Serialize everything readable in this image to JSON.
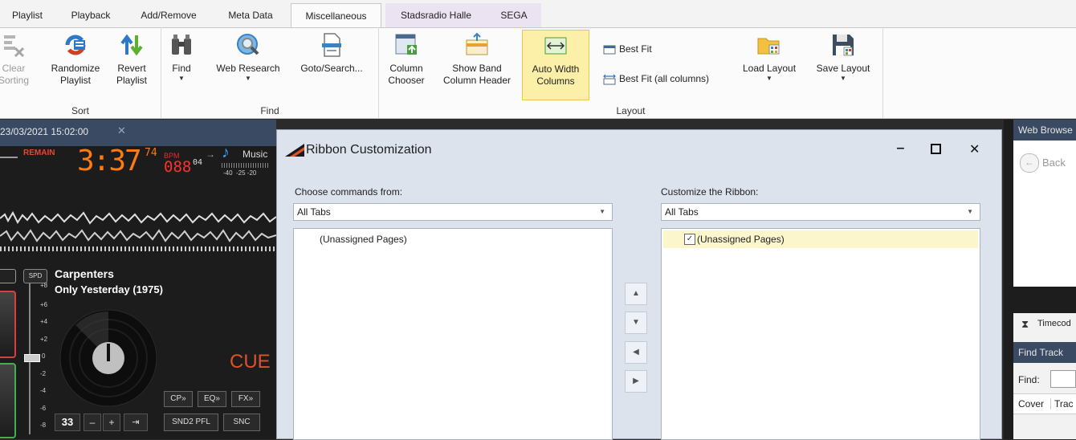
{
  "tabs": [
    {
      "label": "Playlist"
    },
    {
      "label": "Playback"
    },
    {
      "label": "Add/Remove"
    },
    {
      "label": "Meta Data"
    },
    {
      "label": "Miscellaneous"
    },
    {
      "label": "Stadsradio Halle"
    },
    {
      "label": "SEGA"
    }
  ],
  "ribbon": {
    "sort": {
      "label": "Sort",
      "clear": "Clear Sorting",
      "randomize": "Randomize Playlist",
      "revert": "Revert Playlist"
    },
    "find": {
      "label": "Find",
      "find": "Find",
      "web_research": "Web Research",
      "goto": "Goto/Search..."
    },
    "layout": {
      "label": "Layout",
      "column_chooser": "Column Chooser",
      "show_band": "Show Band Column Header",
      "auto_width": "Auto Width Columns",
      "best_fit": "Best Fit",
      "best_fit_all": "Best Fit (all columns)",
      "load_layout": "Load Layout",
      "save_layout": "Save Layout"
    }
  },
  "player": {
    "tab_title": "23/03/2021 15:02:00",
    "remain_label": "REMAIN",
    "time": "3:37",
    "time_frac": "74",
    "bpm_label": "BPM",
    "bpm": "088",
    "bpm_frac": "04",
    "music_label": "Music",
    "meter_scale": "-40  -25 -20",
    "spd": "SPD",
    "artist": "Carpenters",
    "title": "Only Yesterday (1975)",
    "cue": "CUE",
    "pitch_marks": [
      "+8",
      "+6",
      "+4",
      "+2",
      "0",
      "-2",
      "-4",
      "-6",
      "-8"
    ],
    "btn_cp": "CP»",
    "btn_eq": "EQ»",
    "btn_fx": "FX»",
    "num": "33",
    "btn_minus": "–",
    "btn_plus": "+",
    "btn_snd2": "SND2 PFL",
    "btn_snc": "SNC"
  },
  "right": {
    "web_browser": "Web Browse",
    "back": "Back",
    "timecode": "Timecod",
    "find_track": "Find Track",
    "find_label": "Find:",
    "col_cover": "Cover",
    "col_track": "Trac"
  },
  "dialog": {
    "title": "Ribbon Customization",
    "choose_label": "Choose commands from:",
    "choose_value": "All Tabs",
    "left_item": "(Unassigned Pages)",
    "customize_label": "Customize the Ribbon:",
    "customize_value": "All Tabs",
    "right_item": "(Unassigned Pages)"
  }
}
